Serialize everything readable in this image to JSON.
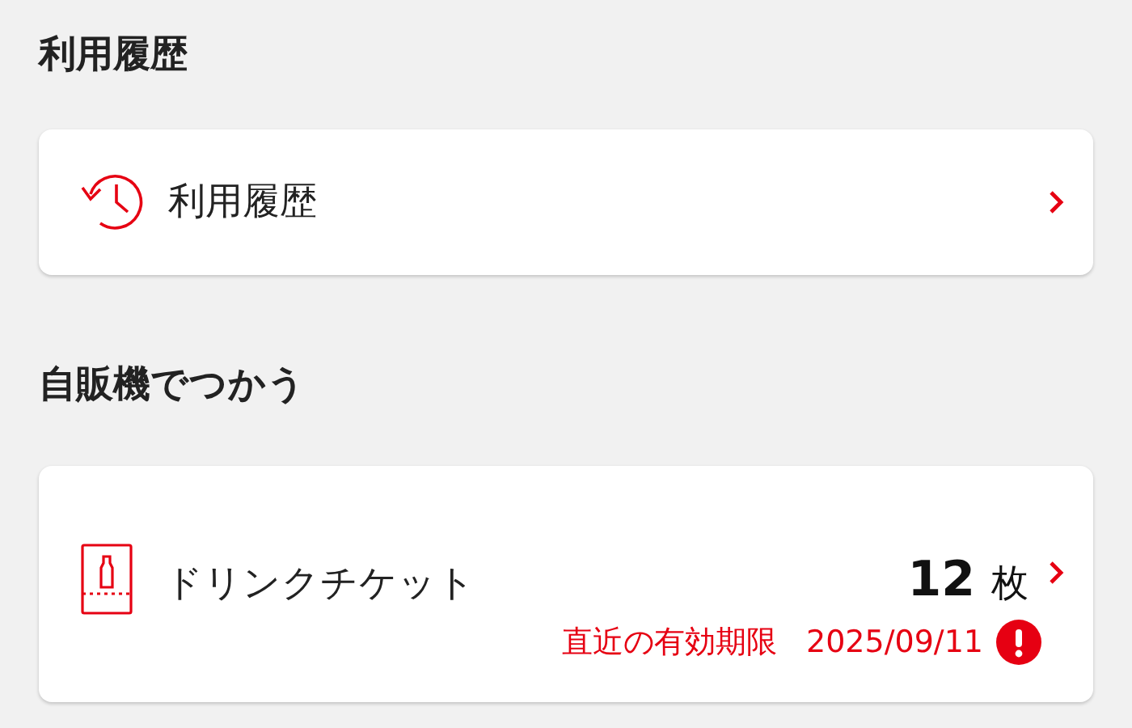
{
  "history_section": {
    "title": "利用履歴",
    "item": {
      "label": "利用履歴"
    }
  },
  "vending_section": {
    "title": "自販機でつかう",
    "ticket": {
      "name": "ドリンクチケット",
      "count": "12",
      "unit": "枚",
      "expiry_label": "直近の有効期限",
      "expiry_date": "2025/09/11",
      "expiring_soon": true
    }
  }
}
